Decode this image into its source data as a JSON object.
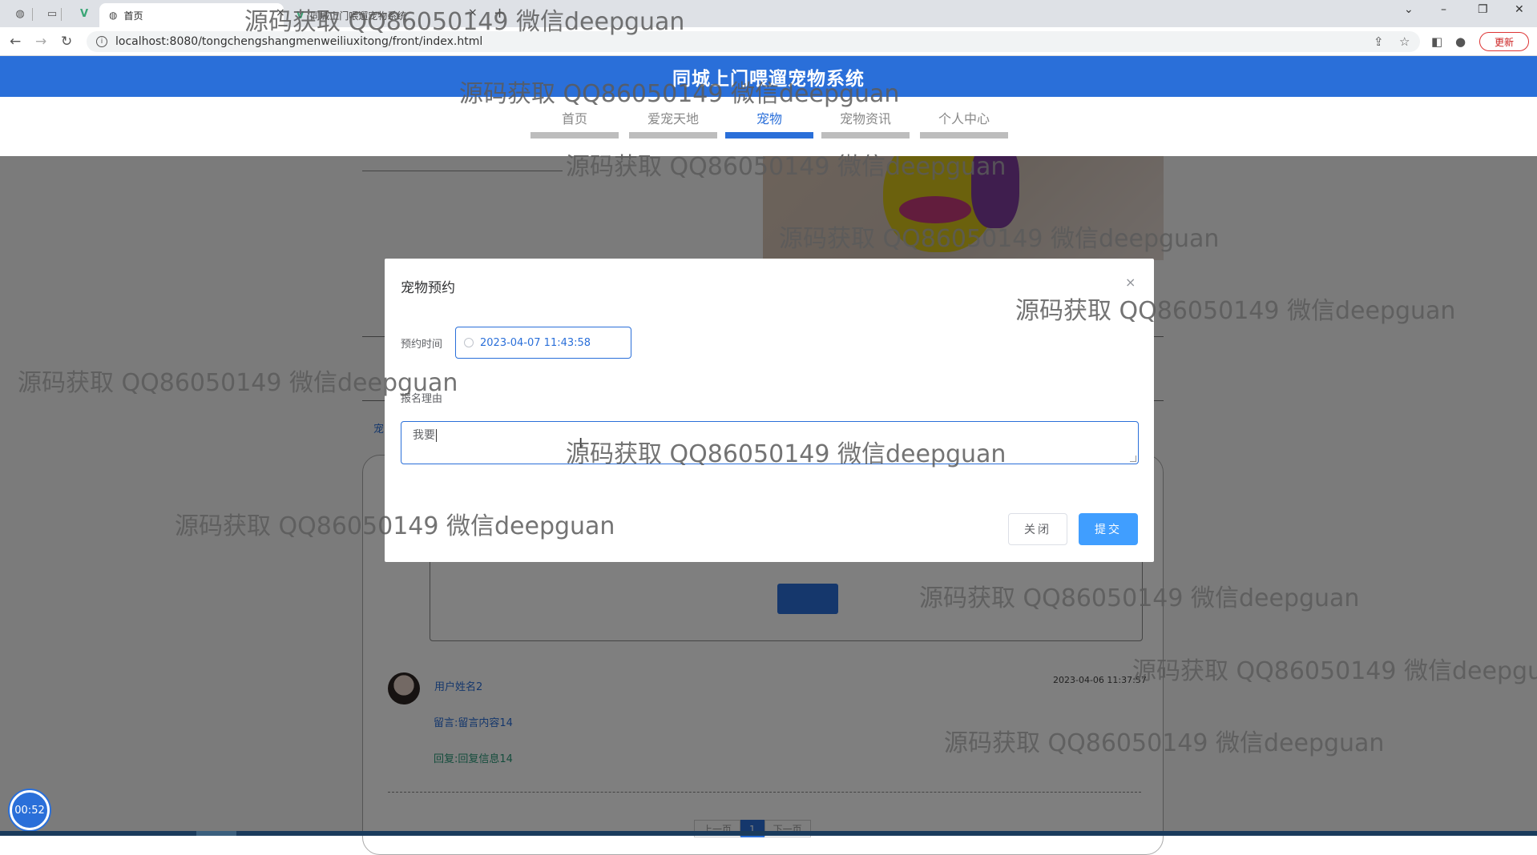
{
  "browser": {
    "active_tab_title": "首页",
    "second_tab_title": "同城上门喂遛宠物系统",
    "url": "localhost:8080/tongchengshangmenweiliuxitong/front/index.html",
    "update_label": "更新"
  },
  "site": {
    "title": "同城上门喂遛宠物系统",
    "nav": [
      {
        "label": "首页"
      },
      {
        "label": "爱宠天地"
      },
      {
        "label": "宠物"
      },
      {
        "label": "宠物资讯"
      },
      {
        "label": "个人中心"
      }
    ],
    "active_nav": "宠物"
  },
  "background_page": {
    "side_link": "宠",
    "comment": {
      "user": "用户姓名2",
      "date": "2023-04-06 11:37:57",
      "message": "留言:留言内容14",
      "reply": "回复:回复信息14"
    },
    "pager": [
      "上一页",
      "1",
      "下一页"
    ]
  },
  "modal": {
    "title": "宠物预约",
    "close_icon": "×",
    "time_label": "预约时间",
    "time_value": "2023-04-07 11:43:58",
    "reason_label": "报名理由",
    "reason_value": "我要",
    "cancel_label": "关闭",
    "submit_label": "提交"
  },
  "watermark": "源码获取 QQ86050149 微信deepguan",
  "timer": "00:52",
  "colors": {
    "brand_blue": "#2a6fd9",
    "primary_button": "#409eff"
  }
}
